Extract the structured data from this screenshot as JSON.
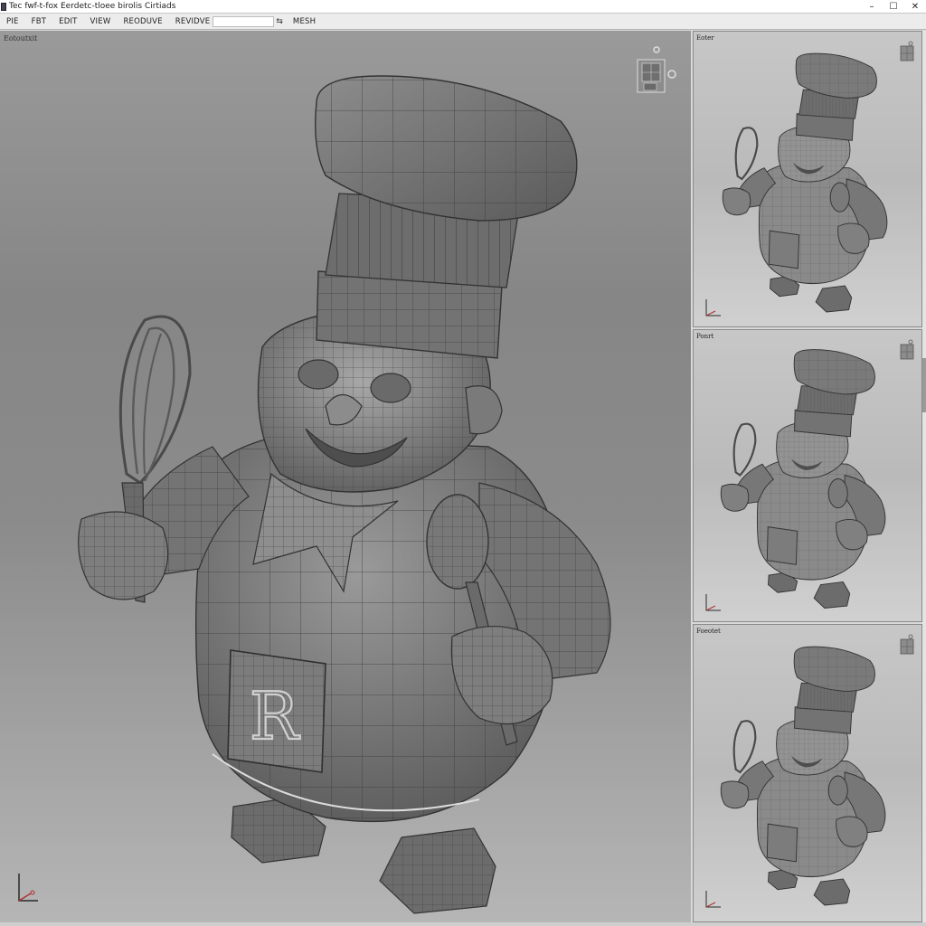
{
  "window": {
    "title": "Tec  fwf-t-fox  Eerdetc-tloee  birolis  Cirtiads",
    "controls": {
      "minimize": "–",
      "maximize": "☐",
      "close": "✕"
    }
  },
  "menu": {
    "items": [
      "PIE",
      "FBT",
      "EDIT",
      "VIEW",
      "REODUVE",
      "REVIDVE"
    ],
    "after_field": "MESH",
    "field_value": ""
  },
  "viewports": {
    "main": {
      "label": "Eotoutxit"
    },
    "side": [
      {
        "label": "Eoter"
      },
      {
        "label": "Ponrt"
      },
      {
        "label": "Foeotet"
      }
    ]
  },
  "model": {
    "apron_monogram": "R"
  },
  "colors": {
    "viewport_bg_top": "#9a9a9a",
    "side_bg": "#c4c4c4",
    "mesh_fill": "#7a7a7a",
    "wire": "#4a4a4a",
    "axis_x": "#b03030",
    "axis_y": "#2a2a2a"
  },
  "icons": [
    "view-cube-icon",
    "axis-gizmo-icon",
    "app-icon",
    "menu-options-icon"
  ]
}
